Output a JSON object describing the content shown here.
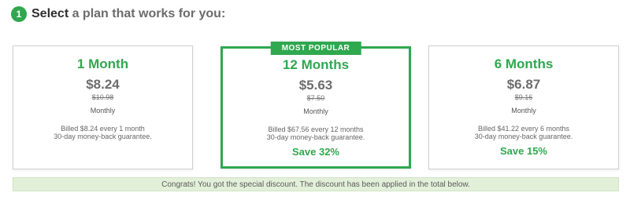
{
  "header": {
    "step_number": "1",
    "title_strong": "Select",
    "title_rest": " a plan that works for you:"
  },
  "plans": [
    {
      "name": "1 Month",
      "price": "$8.24",
      "old_price": "$10.98",
      "period": "Monthly",
      "billed_line1": "Billed $8.24 every 1 month",
      "billed_line2": "30-day money-back guarantee.",
      "save": ""
    },
    {
      "badge": "MOST POPULAR",
      "name": "12 Months",
      "price": "$5.63",
      "old_price": "$7.50",
      "period": "Monthly",
      "billed_line1": "Billed $67.56 every 12 months",
      "billed_line2": "30-day money-back guarantee.",
      "save": "Save 32%"
    },
    {
      "name": "6 Months",
      "price": "$6.87",
      "old_price": "$9.16",
      "period": "Monthly",
      "billed_line1": "Billed $41.22 every 6 months",
      "billed_line2": "30-day money-back guarantee.",
      "save": "Save 15%"
    }
  ],
  "banner": {
    "text": "Congrats! You got the special discount. The discount has been applied in the total below."
  },
  "colors": {
    "accent": "#2fa84f",
    "banner_bg": "#e2f0d9"
  }
}
